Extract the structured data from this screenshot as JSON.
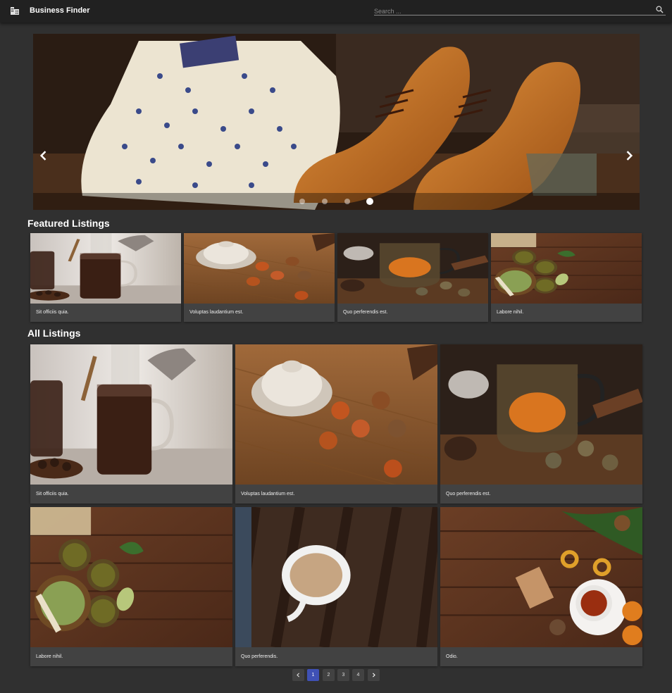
{
  "app": {
    "title": "Business Finder",
    "logo_icon": "building-icon"
  },
  "search": {
    "placeholder": "Search ...",
    "value": "",
    "icon": "search-icon"
  },
  "carousel": {
    "prev_icon": "chevron-left-icon",
    "next_icon": "chevron-right-icon",
    "slide_count": 4,
    "active_index": 3
  },
  "featured": {
    "title": "Featured Listings",
    "items": [
      {
        "caption": "Sit officiis quia."
      },
      {
        "caption": "Voluptas laudantium est."
      },
      {
        "caption": "Quo perferendis est."
      },
      {
        "caption": "Labore nihil."
      }
    ]
  },
  "listings": {
    "title": "All Listings",
    "items": [
      {
        "caption": "Sit officiis quia."
      },
      {
        "caption": "Voluptas laudantium est."
      },
      {
        "caption": "Quo perferendis est."
      },
      {
        "caption": "Labore nihil."
      },
      {
        "caption": "Quo perferendis."
      },
      {
        "caption": "Odio."
      }
    ]
  },
  "pagination": {
    "pages": [
      "1",
      "2",
      "3",
      "4"
    ],
    "current": "1",
    "prev_icon": "chevron-left-icon",
    "next_icon": "chevron-right-icon"
  },
  "colors": {
    "background": "#303030",
    "appbar": "#212121",
    "card": "#424242",
    "accent": "#3f51b5"
  }
}
